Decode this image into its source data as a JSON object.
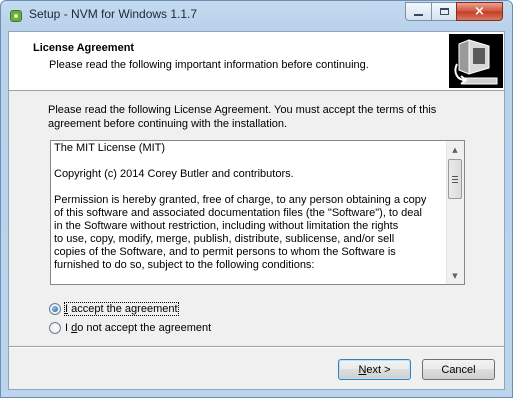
{
  "window": {
    "title": "Setup - NVM for Windows 1.1.7",
    "controls": {
      "minimize": "minimize",
      "maximize": "maximize",
      "close": "×"
    }
  },
  "header": {
    "title": "License Agreement",
    "subtitle": "Please read the following important information before continuing."
  },
  "intro": "Please read the following License Agreement. You must accept the terms of this agreement before continuing with the installation.",
  "license": {
    "text": "The MIT License (MIT)\n\nCopyright (c) 2014 Corey Butler and contributors.\n\nPermission is hereby granted, free of charge, to any person obtaining a copy\nof this software and associated documentation files (the \"Software\"), to deal\nin the Software without restriction, including without limitation the rights\nto use, copy, modify, merge, publish, distribute, sublicense, and/or sell\ncopies of the Software, and to permit persons to whom the Software is\nfurnished to do so, subject to the following conditions:"
  },
  "options": {
    "accept": {
      "access_key": "I",
      "rest": " accept the agreement",
      "selected": true
    },
    "decline_prefix": "I ",
    "decline_key": "d",
    "decline_rest": "o not accept the agreement"
  },
  "buttons": {
    "next_key": "N",
    "next_rest": "ext >",
    "cancel": "Cancel"
  },
  "colors": {
    "titlebar": "#b9d1ea",
    "dialog_bg": "#f0f0f0",
    "default_button_border": "#3c7fb1"
  }
}
